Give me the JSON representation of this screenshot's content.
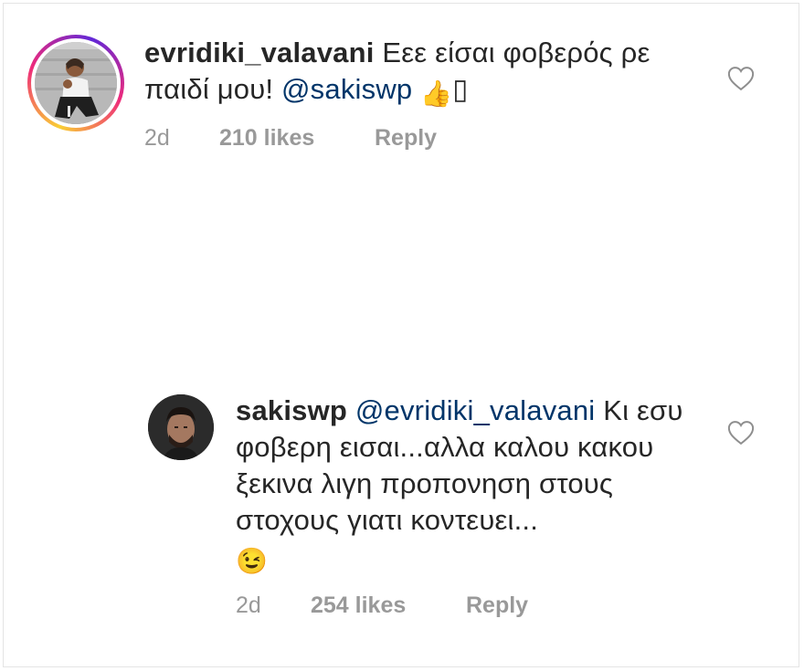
{
  "comments": [
    {
      "username": "evridiki_valavani",
      "text": "Εεε είσαι φοβερός ρε παιδί μου!",
      "mention": "@sakiswp",
      "emoji": "👍",
      "trailing": "▯",
      "time": "2d",
      "likes": "210 likes",
      "reply_label": "Reply"
    },
    {
      "username": "sakiswp",
      "mention": "@evridiki_valavani",
      "text": "Κι εσυ φοβερη εισαι...αλλα καλου κακου ξεκινα λιγη προπονηση στους στοχους γιατι κοντευει...",
      "emoji": "😉",
      "time": "2d",
      "likes": "254 likes",
      "reply_label": "Reply"
    }
  ],
  "icons": {
    "like": "heart-outline-icon",
    "avatar1": "profile-photo",
    "avatar2": "profile-photo"
  },
  "colors": {
    "mention": "#003569",
    "meta": "#999999",
    "text": "#262626"
  }
}
